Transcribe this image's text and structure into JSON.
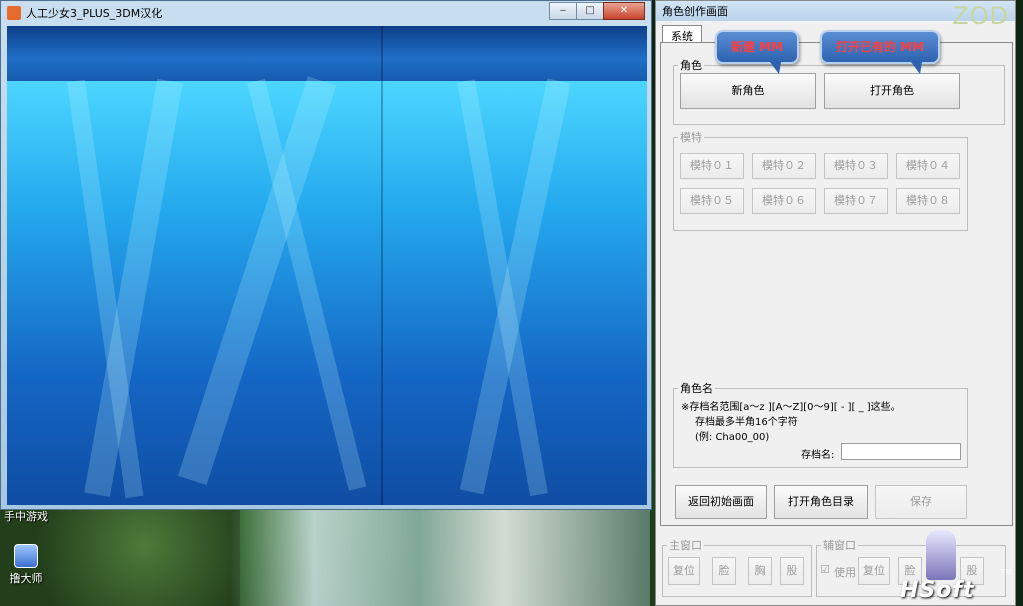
{
  "desktop": {
    "partial_label": "手中游戏",
    "icon_label": "撸大师"
  },
  "game_window": {
    "title": "人工少女3_PLUS_3DM汉化",
    "min": "‒",
    "max": "□",
    "close": "✕"
  },
  "panel": {
    "title": "角色创作画面",
    "watermark": "ZOD",
    "tab": "系统",
    "role_group": {
      "legend": "角色",
      "new_btn": "新角色",
      "open_btn": "打开角色"
    },
    "model_group": {
      "legend": "模特",
      "buttons": [
        "模特０１",
        "模特０２",
        "模特０３",
        "模特０４",
        "模特０５",
        "模特０６",
        "模特０７",
        "模特０８"
      ]
    },
    "name_group": {
      "legend": "角色名",
      "line1": "※存档名范围[a～z ][A～Z][0～9][ - ][ _ ]这些。",
      "line2": "存档最多半角16个字符",
      "line3": "(例: Cha00_00)",
      "field_label": "存档名:",
      "field_value": ""
    },
    "actions": {
      "back": "返回初始画面",
      "open_dir": "打开角色目录",
      "save": "保存"
    },
    "main_window_group": {
      "legend": "主窗口",
      "reset": "复位",
      "face": "脸",
      "chest": "胸",
      "leg": "股"
    },
    "sub_window_group": {
      "legend": "辅窗口",
      "use": "使用",
      "reset": "复位",
      "face": "脸",
      "leg": "股"
    }
  },
  "callouts": {
    "new_mm": "新建 MM",
    "open_mm": "打开已有的 MM"
  },
  "logo": {
    "brand": "HSoft",
    "tm": "TM"
  }
}
